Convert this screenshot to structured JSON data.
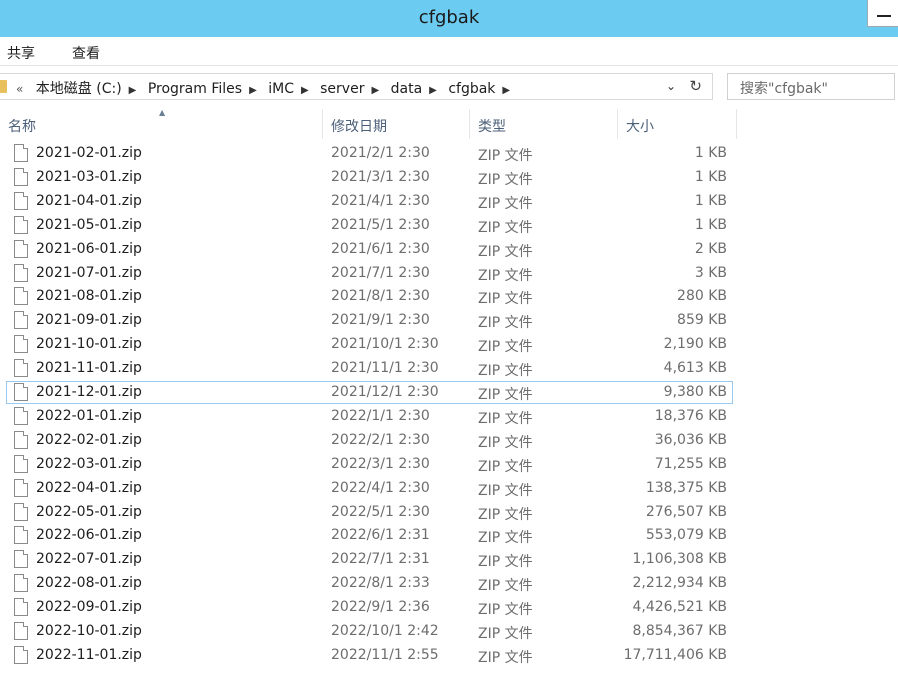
{
  "window": {
    "title": "cfgbak"
  },
  "ribbon": {
    "tabs": [
      "共享",
      "查看"
    ]
  },
  "address": {
    "overflow": "«",
    "crumbs": [
      "本地磁盘 (C:)",
      "Program Files",
      "iMC",
      "server",
      "data",
      "cfgbak"
    ],
    "separator": "▶"
  },
  "search": {
    "placeholder": "搜索\"cfgbak\""
  },
  "columns": {
    "name": "名称",
    "date": "修改日期",
    "type": "类型",
    "size": "大小"
  },
  "selected_index": 10,
  "files": [
    {
      "name": "2021-02-01.zip",
      "date": "2021/2/1 2:30",
      "type": "ZIP 文件",
      "size": "1 KB"
    },
    {
      "name": "2021-03-01.zip",
      "date": "2021/3/1 2:30",
      "type": "ZIP 文件",
      "size": "1 KB"
    },
    {
      "name": "2021-04-01.zip",
      "date": "2021/4/1 2:30",
      "type": "ZIP 文件",
      "size": "1 KB"
    },
    {
      "name": "2021-05-01.zip",
      "date": "2021/5/1 2:30",
      "type": "ZIP 文件",
      "size": "1 KB"
    },
    {
      "name": "2021-06-01.zip",
      "date": "2021/6/1 2:30",
      "type": "ZIP 文件",
      "size": "2 KB"
    },
    {
      "name": "2021-07-01.zip",
      "date": "2021/7/1 2:30",
      "type": "ZIP 文件",
      "size": "3 KB"
    },
    {
      "name": "2021-08-01.zip",
      "date": "2021/8/1 2:30",
      "type": "ZIP 文件",
      "size": "280 KB"
    },
    {
      "name": "2021-09-01.zip",
      "date": "2021/9/1 2:30",
      "type": "ZIP 文件",
      "size": "859 KB"
    },
    {
      "name": "2021-10-01.zip",
      "date": "2021/10/1 2:30",
      "type": "ZIP 文件",
      "size": "2,190 KB"
    },
    {
      "name": "2021-11-01.zip",
      "date": "2021/11/1 2:30",
      "type": "ZIP 文件",
      "size": "4,613 KB"
    },
    {
      "name": "2021-12-01.zip",
      "date": "2021/12/1 2:30",
      "type": "ZIP 文件",
      "size": "9,380 KB"
    },
    {
      "name": "2022-01-01.zip",
      "date": "2022/1/1 2:30",
      "type": "ZIP 文件",
      "size": "18,376 KB"
    },
    {
      "name": "2022-02-01.zip",
      "date": "2022/2/1 2:30",
      "type": "ZIP 文件",
      "size": "36,036 KB"
    },
    {
      "name": "2022-03-01.zip",
      "date": "2022/3/1 2:30",
      "type": "ZIP 文件",
      "size": "71,255 KB"
    },
    {
      "name": "2022-04-01.zip",
      "date": "2022/4/1 2:30",
      "type": "ZIP 文件",
      "size": "138,375 KB"
    },
    {
      "name": "2022-05-01.zip",
      "date": "2022/5/1 2:30",
      "type": "ZIP 文件",
      "size": "276,507 KB"
    },
    {
      "name": "2022-06-01.zip",
      "date": "2022/6/1 2:31",
      "type": "ZIP 文件",
      "size": "553,079 KB"
    },
    {
      "name": "2022-07-01.zip",
      "date": "2022/7/1 2:31",
      "type": "ZIP 文件",
      "size": "1,106,308 KB"
    },
    {
      "name": "2022-08-01.zip",
      "date": "2022/8/1 2:33",
      "type": "ZIP 文件",
      "size": "2,212,934 KB"
    },
    {
      "name": "2022-09-01.zip",
      "date": "2022/9/1 2:36",
      "type": "ZIP 文件",
      "size": "4,426,521 KB"
    },
    {
      "name": "2022-10-01.zip",
      "date": "2022/10/1 2:42",
      "type": "ZIP 文件",
      "size": "8,854,367 KB"
    },
    {
      "name": "2022-11-01.zip",
      "date": "2022/11/1 2:55",
      "type": "ZIP 文件",
      "size": "17,711,406 KB"
    }
  ]
}
